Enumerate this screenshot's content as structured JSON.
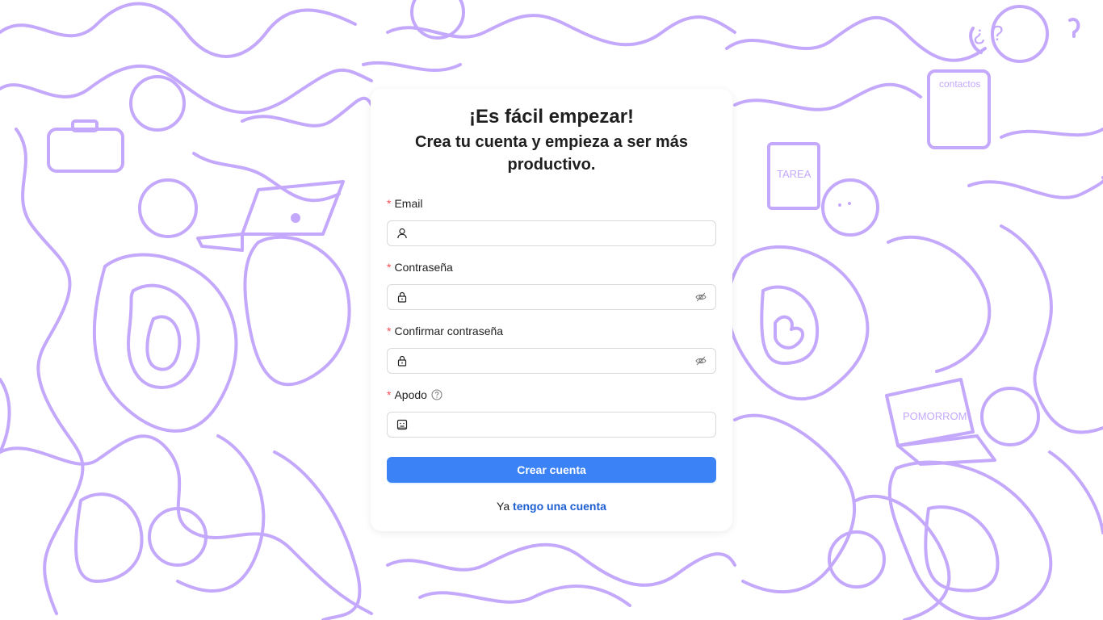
{
  "colors": {
    "doodle": "#c4a8fb",
    "primary": "#3b82f6",
    "link": "#1d5fd1",
    "required": "#ff4d4f"
  },
  "background": {
    "doodle_labels": {
      "notebook": "TAREA",
      "phonebook": "contactos",
      "laptop_screen": "POMORROM",
      "question_marks": "¿ ?"
    }
  },
  "form": {
    "title": "¡Es fácil empezar!",
    "subtitle": "Crea tu cuenta y empieza a ser más productivo.",
    "fields": {
      "email": {
        "label": "Email",
        "required_mark": "*",
        "value": "",
        "prefix_icon": "user-icon"
      },
      "password": {
        "label": "Contraseña",
        "required_mark": "*",
        "value": "",
        "prefix_icon": "lock-icon",
        "suffix_icon": "eye-invisible-icon"
      },
      "confirm_password": {
        "label": "Confirmar contraseña",
        "required_mark": "*",
        "value": "",
        "prefix_icon": "lock-icon",
        "suffix_icon": "eye-invisible-icon"
      },
      "nickname": {
        "label": "Apodo",
        "required_mark": "*",
        "value": "",
        "prefix_icon": "smile-icon",
        "help_icon": "question-circle-icon"
      }
    },
    "submit_label": "Crear cuenta",
    "login_prompt": "Ya",
    "login_link": "tengo una cuenta"
  }
}
